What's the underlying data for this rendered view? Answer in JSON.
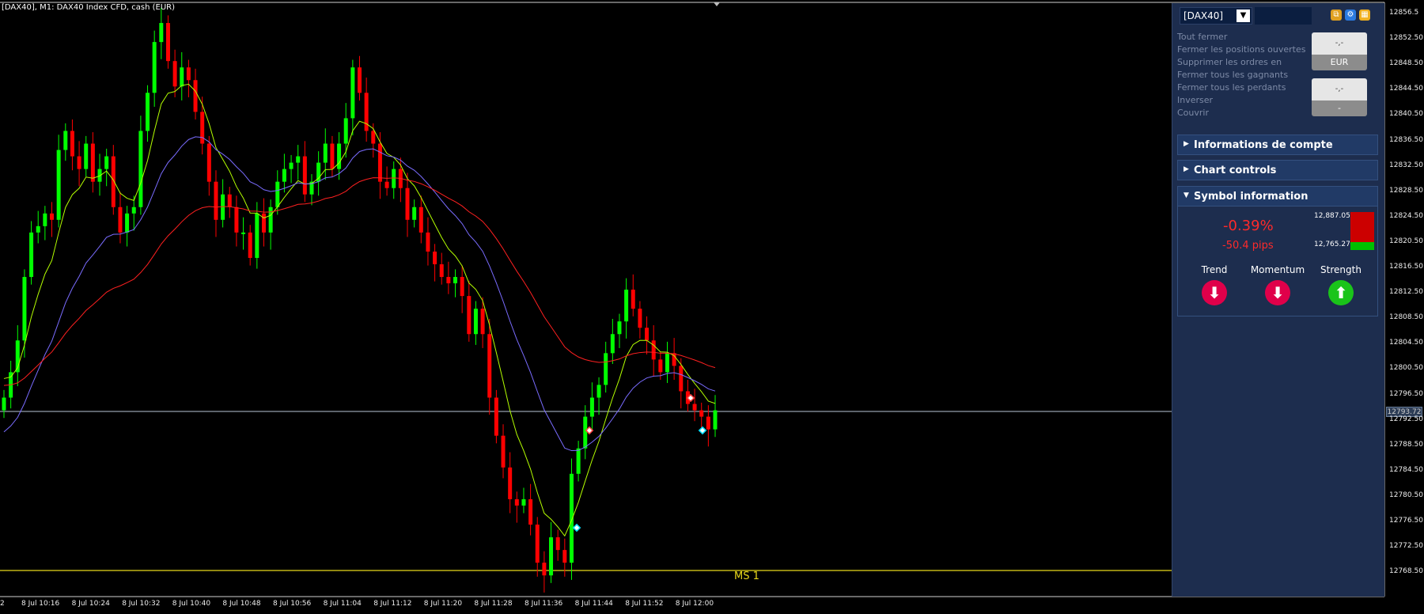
{
  "chart": {
    "title": "[DAX40], M1:  DAX40 Index CFD, cash (EUR)",
    "current_price": "12793.72",
    "ms_label": "MS 1",
    "price_axis": [
      "12856.5",
      "12852.50",
      "12848.50",
      "12844.50",
      "12840.50",
      "12836.50",
      "12832.50",
      "12828.50",
      "12824.50",
      "12820.50",
      "12816.50",
      "12812.50",
      "12808.50",
      "12804.50",
      "12800.50",
      "12796.50",
      "12792.50",
      "12788.50",
      "12784.50",
      "12780.50",
      "12776.50",
      "12772.50",
      "12768.50"
    ],
    "time_axis": [
      "2",
      "8 Jul 10:16",
      "8 Jul 10:24",
      "8 Jul 10:32",
      "8 Jul 10:40",
      "8 Jul 10:48",
      "8 Jul 10:56",
      "8 Jul 11:04",
      "8 Jul 11:12",
      "8 Jul 11:20",
      "8 Jul 11:28",
      "8 Jul 11:36",
      "8 Jul 11:44",
      "8 Jul 11:52",
      "8 Jul 12:00"
    ],
    "colors": {
      "bull": "#00ff00",
      "bear": "#ff0000",
      "ma_fast": "#b4ff00",
      "ma_mid": "#7a6cff",
      "ma_slow": "#ff2020",
      "level": "#e8d81a"
    }
  },
  "panel": {
    "symbol": "[DAX40]",
    "actions": [
      "Tout fermer",
      "Fermer les positions ouvertes",
      "Supprimer les ordres en",
      "Fermer tous les gagnants",
      "Fermer tous les perdants",
      "Inverser",
      "Couvrir"
    ],
    "value1": "-,-",
    "currency": "EUR",
    "value2": "-,-",
    "value2_sub": "-",
    "sections": [
      "Informations de compte",
      "Chart controls",
      "Symbol information"
    ],
    "symbol_info": {
      "percent": "-0.39%",
      "pips": "-50.4 pips",
      "high": "12,887.05",
      "low": "12,765.27",
      "indicators": [
        {
          "label": "Trend",
          "direction": "down"
        },
        {
          "label": "Momentum",
          "direction": "down"
        },
        {
          "label": "Strength",
          "direction": "up"
        }
      ]
    }
  }
}
